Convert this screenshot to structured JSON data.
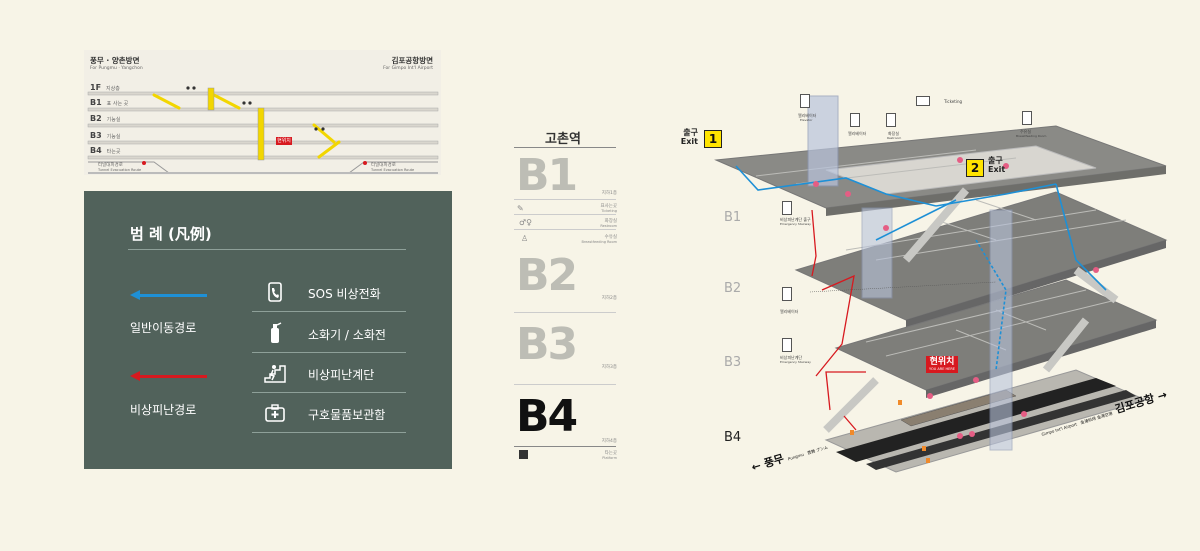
{
  "section": {
    "left_dest": "풍무 · 양촌방면",
    "left_dest_en": "For Pungmu · Yangchon",
    "right_dest": "김포공항방면",
    "right_dest_en": "For Gimpo Int'l Airport",
    "floors": [
      {
        "code": "1F",
        "desc": "지상층"
      },
      {
        "code": "B1",
        "desc": "표 사는 곳"
      },
      {
        "code": "B2",
        "desc": "기능실"
      },
      {
        "code": "B3",
        "desc": "기능실"
      },
      {
        "code": "B4",
        "desc": "타는곳"
      }
    ],
    "here_label": "현위치",
    "tunnel_left": "터널대피경로",
    "tunnel_left_en": "Tunnel Evacuation Route",
    "tunnel_right": "터널대피경로",
    "tunnel_right_en": "Tunnel Evacuation Route"
  },
  "legend": {
    "title": "범 례 (凡例)",
    "routes": [
      {
        "label": "일반이동경로",
        "color": "#1e90d6"
      },
      {
        "label": "비상피난경로",
        "color": "#d7191f"
      }
    ],
    "items": [
      {
        "label": "SOS 비상전화",
        "icon": "sos-phone-icon"
      },
      {
        "label": "소화기 / 소화전",
        "icon": "fire-extinguisher-icon"
      },
      {
        "label": "비상피난계단",
        "icon": "emergency-stairs-icon"
      },
      {
        "label": "구호물품보관함",
        "icon": "first-aid-box-icon"
      }
    ]
  },
  "floor_index": {
    "station": "고촌역",
    "floors": [
      {
        "code": "B1",
        "sub": "지하1층",
        "items": [
          "표사는곳",
          "화장실",
          "수유실"
        ],
        "items_en": [
          "Ticketing",
          "Restroom",
          "Breastfeeding Room"
        ]
      },
      {
        "code": "B2",
        "sub": "지하2층"
      },
      {
        "code": "B3",
        "sub": "지하3층"
      },
      {
        "code": "B4",
        "sub": "지하4층",
        "items": [
          "타는곳"
        ],
        "items_en": [
          "Platform"
        ]
      }
    ],
    "current": "B4"
  },
  "map": {
    "exit1": {
      "num": "1",
      "ko": "출구",
      "en": "Exit"
    },
    "exit2": {
      "num": "2",
      "ko": "출구",
      "en": "Exit"
    },
    "level_labels": [
      "B1",
      "B2",
      "B3",
      "B4"
    ],
    "current_level": "B4",
    "here": {
      "ko": "현위치",
      "en": "YOU ARE HERE"
    },
    "dir_left": {
      "ko": "풍무",
      "en": "Pungmu",
      "jp": "豊舞 プンム"
    },
    "dir_right": {
      "ko": "김포공항",
      "en": "Gimpo Int'l Airport",
      "cn": "金浦机场 金浦空港"
    },
    "facility_labels": {
      "elevator": "엘리베이터",
      "elevator_en": "Elevator",
      "restroom": "화장실",
      "restroom_en": "Restroom",
      "ticketing_en": "Ticketing",
      "nursing": "수유실",
      "nursing_en": "Breastfeeding Room",
      "emergency_exit": "비상피난계단 출구",
      "emergency_exit_en": "Emergency Stairway",
      "emergency_stairs": "비상피난계단",
      "emergency_stairs_en": "Emergency Stairway"
    },
    "colors": {
      "normal_route": "#1e90d6",
      "emergency_route": "#d7191f",
      "exit_yellow": "#ffe400"
    }
  }
}
